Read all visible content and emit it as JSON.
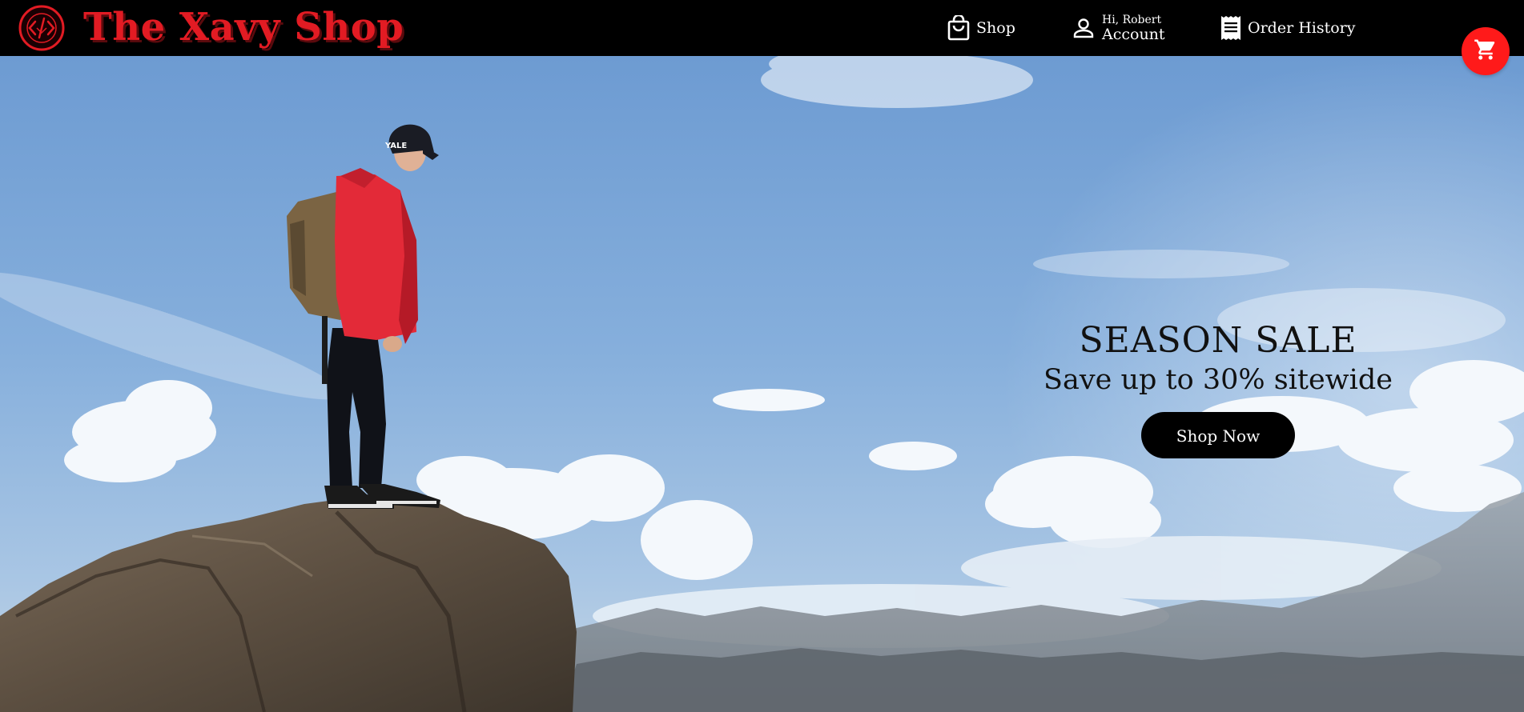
{
  "header": {
    "brand": "The Xavy Shop",
    "logo_icon": "code-brackets-logo-icon",
    "nav": {
      "shop_label": "Shop",
      "greeting": "Hi, Robert",
      "account_label": "Account",
      "orders_label": "Order History"
    },
    "icons": {
      "shop": "shopping-bag-icon",
      "account": "person-icon",
      "orders": "receipt-icon",
      "cart": "cart-icon"
    }
  },
  "hero": {
    "title": "SEASON SALE",
    "subtitle": "Save up to 30% sitewide",
    "cta_label": "Shop Now"
  },
  "colors": {
    "header_bg": "#000000",
    "brand_red": "#e21b23",
    "cart_fab": "#ff1a1a",
    "cta_bg": "#000000",
    "sky": "#7fa9da"
  }
}
